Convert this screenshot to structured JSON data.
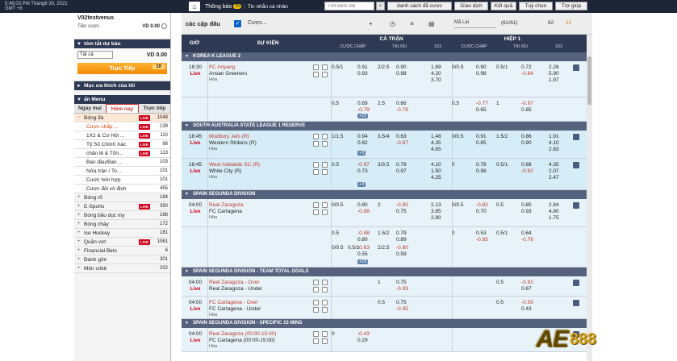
{
  "topbar": {
    "time": "5:46:03 PM Tháng8 30, 2021 GMT +8",
    "notice": "Thông báo",
    "notice_badge": "25",
    "messages": "Tin nhắn cá nhân",
    "search_placeholder": "Tìm kiếm đội",
    "buttons": [
      "danh sách đã cược",
      "Giao dịch",
      "Kết quả",
      "Tuỳ chọn",
      "Trợ giúp"
    ]
  },
  "sidebar": {
    "username": "V02testvenus",
    "credit_label": "Tiền cược",
    "credit_value": "VD 0.00",
    "bet_section": "tóm tắt dự báo",
    "bet_select": "Tất cả",
    "bet_value": "VD 0.00",
    "live_label": "Trực Tiếp",
    "live_count": "10",
    "favorites": "Mục ưa thích của tôi",
    "menu_title": "ẩn Menu",
    "tabs": [
      "Ngày mai",
      "Hôm nay",
      "Trực tiếp"
    ],
    "items": [
      {
        "label": "Bóng đá",
        "live": "LIVE",
        "count": "1048",
        "kind": "sport first"
      },
      {
        "label": "Cược chấp ...",
        "live": "LIVE",
        "count": "139",
        "kind": "sub active"
      },
      {
        "label": "1X2 & Cơ Hội ...",
        "live": "LIVE",
        "count": "110",
        "kind": "sub"
      },
      {
        "label": "Tỷ Số Chính Xác",
        "live": "LIVE",
        "count": "86",
        "kind": "sub"
      },
      {
        "label": "chẵn lẻ & Tổn...",
        "live": "LIVE",
        "count": "113",
        "kind": "sub"
      },
      {
        "label": "Bàn đầu/Bàn ...",
        "live": "",
        "count": "103",
        "kind": "sub"
      },
      {
        "label": "Nửa trận / To...",
        "live": "",
        "count": "101",
        "kind": "sub"
      },
      {
        "label": "Cược hỗn hợp",
        "live": "",
        "count": "101",
        "kind": "sub"
      },
      {
        "label": "Cược đội vô địch",
        "live": "",
        "count": "455",
        "kind": "sub"
      },
      {
        "label": "Bóng rổ",
        "live": "",
        "count": "184",
        "kind": "sport"
      },
      {
        "label": "E-Sports",
        "live": "LIVE",
        "count": "390",
        "kind": "sport"
      },
      {
        "label": "Bóng bầu dục my",
        "live": "",
        "count": "166",
        "kind": "sport"
      },
      {
        "label": "Bóng chày",
        "live": "",
        "count": "172",
        "kind": "sport"
      },
      {
        "label": "Ice Hockey",
        "live": "",
        "count": "181",
        "kind": "sport"
      },
      {
        "label": "Quần vợt",
        "live": "LIVE",
        "count": "1061",
        "kind": "sport"
      },
      {
        "label": "Financial Bets",
        "live": "",
        "count": "6",
        "kind": "sport"
      },
      {
        "label": "Đánh gôn",
        "live": "",
        "count": "301",
        "kind": "sport"
      },
      {
        "label": "Môn crikê",
        "live": "",
        "count": "202",
        "kind": "sport"
      }
    ]
  },
  "main": {
    "title": "các cập đấu",
    "cuoc": "Cược...",
    "odds_type": "Mã Lai",
    "page": "(61/61)",
    "count": "62",
    "fav": "12",
    "head": {
      "time": "GIỜ",
      "event": "SỰ KIỆN",
      "full": "CẢ TRẬN",
      "half": "HIỆP 1",
      "hdp": "CƯỢC CHẤP",
      "ou": "TÀI XỈU",
      "x12": "1X2"
    }
  },
  "rows": [
    {
      "type": "league",
      "label": "KOREA K LEAGUE 2"
    },
    {
      "type": "match",
      "bg": "norm",
      "h": 45,
      "time": "18:30",
      "live": "Live",
      "home": "FC Anyang",
      "away": "Ansan Greeners",
      "draw": "Hòa",
      "c": [
        [
          "0.5/1",
          "",
          "",
          "0.91",
          "0.93",
          "2/2.5",
          "",
          "0.90",
          "0.98",
          "1.69",
          "4.20",
          "3.70",
          "0/0.5",
          "",
          "0.90",
          "0.98",
          "0.5/1",
          "",
          "0.72",
          "-0.84",
          "2.26",
          "5.90",
          "1.97"
        ]
      ]
    },
    {
      "type": "sub",
      "bg": "norm",
      "h": 30,
      "more": "+15",
      "c": [
        [
          "0.5",
          "",
          "",
          "0.69",
          "-0.79",
          "2.5",
          "",
          "0.66",
          "-0.78",
          "",
          "",
          "",
          "0.5",
          "",
          "-0.77",
          "0.65",
          "1",
          "",
          "-0.97",
          "0.85",
          "",
          "",
          ""
        ]
      ]
    },
    {
      "type": "league",
      "label": "SOUTH AUSTRALIA STATE LEAGUE 1 RESERVE"
    },
    {
      "type": "match",
      "bg": "alt",
      "h": 35,
      "time": "18:45",
      "live": "Live",
      "home": "Modbury Jets (R)",
      "away": "Western Strikers (R)",
      "draw": "Hòa",
      "more": "+3",
      "c": [
        [
          "1/1.5",
          "",
          "",
          "0.94",
          "0.82",
          "3.5/4",
          "",
          "0.63",
          "-0.87",
          "1.48",
          "4.35",
          "4.65",
          "0/0.5",
          "",
          "0.91",
          "0.85",
          "1.5/2",
          "",
          "0.86",
          "0.90",
          "1.91",
          "4.10",
          "2.83"
        ]
      ]
    },
    {
      "type": "match",
      "bg": "alt",
      "h": 39,
      "time": "18:45",
      "live": "Live",
      "home": "West Adelaide SC (R)",
      "away": "White City (R)",
      "draw": "Hòa",
      "more": "+3",
      "c": [
        [
          "0.5",
          "",
          "",
          "-0.97",
          "0.73",
          "3/3.5",
          "",
          "0.79",
          "0.97",
          "4.10",
          "1.50",
          "4.25",
          "0",
          "",
          "0.78",
          "0.98",
          "0.5/1",
          "",
          "0.68",
          "-0.92",
          "4.35",
          "2.07",
          "2.47"
        ]
      ]
    },
    {
      "type": "league",
      "label": "SPAIN SEGUNDA DIVISION"
    },
    {
      "type": "match",
      "bg": "norm",
      "h": 35,
      "time": "04:00",
      "live": "Live",
      "home": "Real Zaragoza",
      "away": "FC Cartagena",
      "draw": "Hòa",
      "c": [
        [
          "0/0.5",
          "",
          "",
          "0.80",
          "-0.88",
          "2",
          "",
          "-0.85",
          "0.75",
          "2.13",
          "3.85",
          "2.80",
          "0/0.5",
          "",
          "-0.82",
          "0.70",
          "0.5",
          "",
          "0.85",
          "0.93",
          "2.84",
          "4.80",
          "1.75"
        ]
      ]
    },
    {
      "type": "sub",
      "bg": "norm",
      "h": 50,
      "more": "+15",
      "c": [
        [
          "0.5",
          "",
          "",
          "-0.88",
          "0.80",
          "1.5/2",
          "",
          "0.79",
          "0.89",
          "",
          "",
          "",
          "0",
          "",
          "0.53",
          "-0.65",
          "0.5/1",
          "",
          "0.64",
          "-0.76",
          "",
          "",
          ""
        ],
        [
          "0/0.5",
          "0.5/1",
          "",
          "-0.63",
          "0.55",
          "2/2.5",
          "",
          "-0.80",
          "0.59",
          "",
          "",
          "",
          "",
          "",
          "",
          "",
          "",
          "",
          "",
          "",
          "",
          "",
          ""
        ]
      ]
    },
    {
      "type": "league",
      "label": "SPAIN SEGUNDA DIVISION - TEAM TOTAL GOALS"
    },
    {
      "type": "match",
      "bg": "norm",
      "h": 25,
      "time": "04:00",
      "live": "Live",
      "home": "Real Zaragoza - Over",
      "away": "Real Zaragoza - Under",
      "draw": "",
      "c": [
        [
          "",
          "",
          "",
          "",
          "",
          "1",
          "",
          "0.75",
          "-0.99",
          "",
          "",
          "",
          "",
          "",
          "",
          "",
          "0.5",
          "",
          "-0.91",
          "0.67",
          "",
          "",
          ""
        ]
      ]
    },
    {
      "type": "match",
      "bg": "norm",
      "h": 28,
      "time": "04:00",
      "live": "Live",
      "home": "FC Cartagena - Over",
      "away": "FC Cartagena - Under",
      "draw": "Hòa",
      "c": [
        [
          "",
          "",
          "",
          "",
          "",
          "0.5",
          "",
          "0.75",
          "-0.95",
          "",
          "",
          "",
          "",
          "",
          "",
          "",
          "0.5",
          "",
          "-0.59",
          "0.43",
          "",
          "",
          ""
        ]
      ]
    },
    {
      "type": "league",
      "label": "SPAIN SEGUNDA DIVISION - SPECIFIC 15 MINS"
    },
    {
      "type": "match",
      "bg": "norm",
      "h": 30,
      "time": "04:00",
      "live": "Live",
      "home": "Real Zaragoza (00:00-15:00)",
      "away": "FC Cartagena (00:00-15:00)",
      "draw": "Hòa",
      "c": [
        [
          "0",
          "",
          "",
          "-0.43",
          "0.29",
          "",
          "",
          "",
          "",
          "",
          "",
          "",
          "",
          "",
          "",
          "",
          "",
          "",
          "",
          "",
          "",
          "",
          ""
        ]
      ]
    }
  ],
  "logo": {
    "ae": "AE",
    "num": "888"
  }
}
